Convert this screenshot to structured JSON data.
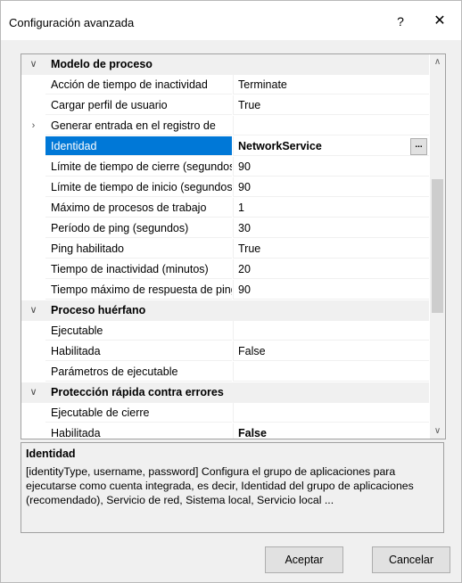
{
  "window": {
    "title": "Configuración avanzada",
    "help_label": "?",
    "close_label": "✕"
  },
  "grid": {
    "rows": [
      {
        "type": "category",
        "toggle": "∨",
        "name": "Modelo de proceso"
      },
      {
        "type": "property",
        "name": "Acción de tiempo de inactividad",
        "value": "Terminate"
      },
      {
        "type": "property",
        "name": "Cargar perfil de usuario",
        "value": "True"
      },
      {
        "type": "property",
        "toggle": "›",
        "name": "Generar entrada en el registro de",
        "value": ""
      },
      {
        "type": "property",
        "name": "Identidad",
        "value": "NetworkService",
        "selected": true,
        "bold": true,
        "button": "..."
      },
      {
        "type": "property",
        "name": "Límite de tiempo de cierre (segundos)",
        "value": "90"
      },
      {
        "type": "property",
        "name": "Límite de tiempo de inicio (segundos)",
        "value": "90"
      },
      {
        "type": "property",
        "name": "Máximo de procesos de trabajo",
        "value": "1"
      },
      {
        "type": "property",
        "name": "Período de ping (segundos)",
        "value": "30"
      },
      {
        "type": "property",
        "name": "Ping habilitado",
        "value": "True"
      },
      {
        "type": "property",
        "name": "Tiempo de inactividad (minutos)",
        "value": "20"
      },
      {
        "type": "property",
        "name": "Tiempo máximo de respuesta de ping",
        "value": "90"
      },
      {
        "type": "category",
        "toggle": "∨",
        "name": "Proceso huérfano"
      },
      {
        "type": "property",
        "name": "Ejecutable",
        "value": ""
      },
      {
        "type": "property",
        "name": "Habilitada",
        "value": "False"
      },
      {
        "type": "property",
        "name": "Parámetros de ejecutable",
        "value": ""
      },
      {
        "type": "category",
        "toggle": "∨",
        "name": "Protección rápida contra errores"
      },
      {
        "type": "property",
        "name": "Ejecutable de cierre",
        "value": ""
      },
      {
        "type": "property",
        "name": "Habilitada",
        "value": "False",
        "bold": true
      }
    ]
  },
  "scrollbar": {
    "up_arrow": "∧",
    "down_arrow": "∨"
  },
  "description": {
    "title": "Identidad",
    "text": "[identityType, username, password] Configura el grupo de aplicaciones para ejecutarse como cuenta integrada, es decir, Identidad del grupo de aplicaciones (recomendado), Servicio de red, Sistema local, Servicio local ..."
  },
  "buttons": {
    "accept_label": "Aceptar",
    "cancel_label": "Cancelar"
  }
}
